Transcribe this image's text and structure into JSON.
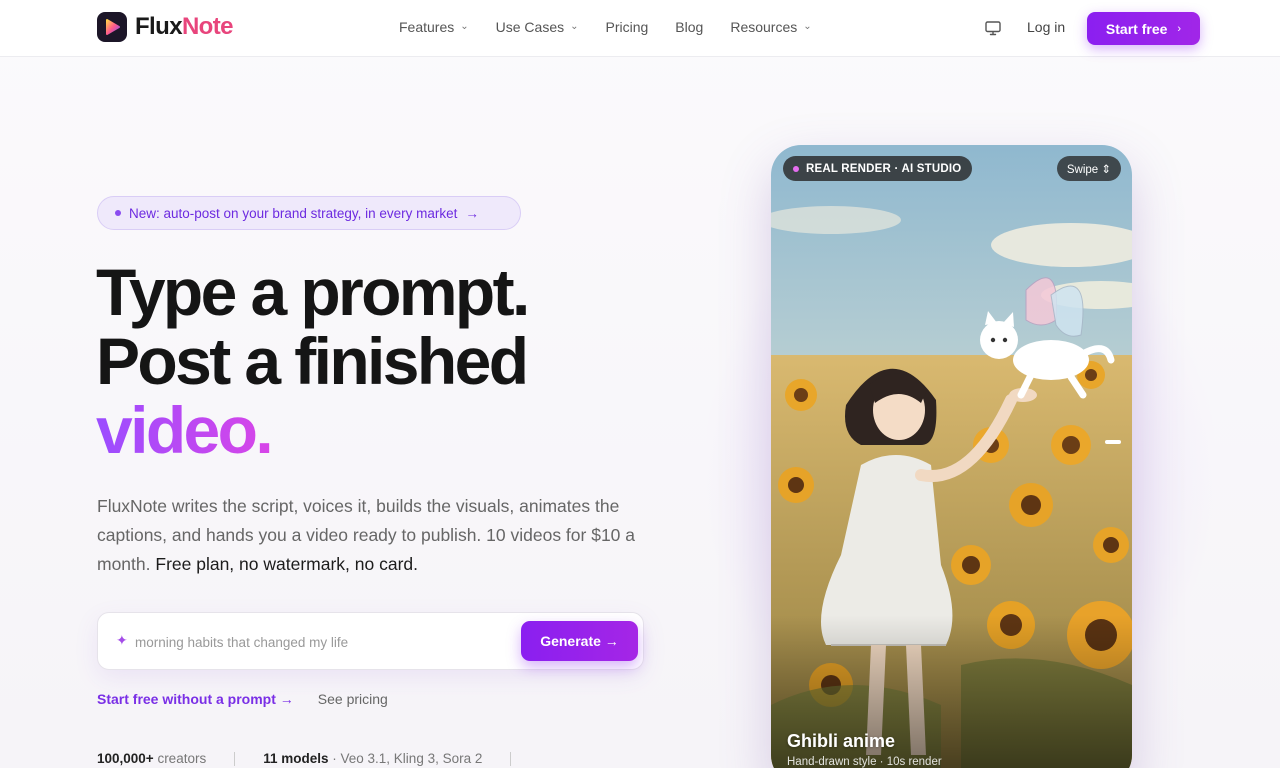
{
  "brand": {
    "name_main": "Flux",
    "name_accent": "Note"
  },
  "nav": {
    "links": [
      {
        "label": "Features",
        "has_dropdown": true
      },
      {
        "label": "Use Cases",
        "has_dropdown": true
      },
      {
        "label": "Pricing",
        "has_dropdown": false
      },
      {
        "label": "Blog",
        "has_dropdown": false
      },
      {
        "label": "Resources",
        "has_dropdown": true
      }
    ],
    "chevron": "⌄",
    "login": "Log in",
    "cta": "Start free",
    "cta_arrow": "›"
  },
  "hero": {
    "badge": "New: auto-post on your brand strategy, in every market",
    "badge_arrow": "→",
    "headline_line1": "Type a prompt.",
    "headline_line2": "Post a finished",
    "headline_line3": "video.",
    "subtext": "FluxNote writes the script, voices it, builds the visuals, animates the captions, and hands you a video ready to publish. 10 videos for $10 a month. ",
    "subtext_strong": "Free plan, no watermark, no card.",
    "prompt": {
      "placeholder": "morning habits that changed my life",
      "value": "",
      "sparkle": "✦",
      "button": "Generate →"
    },
    "link_primary": "Start free without a prompt →",
    "link_secondary": "See pricing",
    "stats": [
      {
        "bold": "100,000+",
        "text": " creators"
      },
      {
        "bold": "11 models",
        "text": " · Veo 3.1, Kling 3, Sora 2"
      }
    ]
  },
  "preview": {
    "tag": "REAL RENDER · AI STUDIO",
    "swipe": "Swipe ⇕",
    "title": "Ghibli anime",
    "subtitle": "Hand-drawn style · 10s render"
  },
  "colors": {
    "accent": "#8b1ff0",
    "brand_pink": "#e8457c",
    "gradient_end": "#d845e8"
  }
}
